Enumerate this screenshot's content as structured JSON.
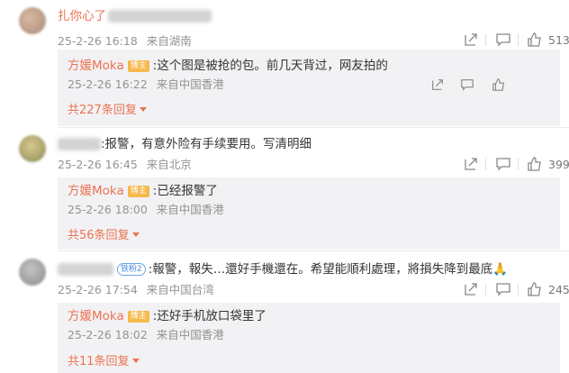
{
  "comments": [
    {
      "author": "扎你心了",
      "text_visible": "",
      "date": "25-2-26 16:18",
      "location": "来自湖南",
      "likes": "513",
      "reply": {
        "author": "方媛Moka",
        "badge": "博主",
        "text": ":这个图是被抢的包。前几天背过，网友拍的",
        "date": "25-2-26 16:22",
        "location": "来自中国香港"
      },
      "more_replies": "共227条回复"
    },
    {
      "author": "",
      "text_visible": ":报警，有意外险有手续要用。写清明细",
      "date": "25-2-26 16:45",
      "location": "来自北京",
      "likes": "399",
      "reply": {
        "author": "方媛Moka",
        "badge": "博主",
        "text": ":已经报警了",
        "date": "25-2-26 18:00",
        "location": "来自中国香港"
      },
      "more_replies": "共56条回复"
    },
    {
      "author": "",
      "user_badge": "铁粉2",
      "text_visible": ":報警，報失…還好手機還在。希望能順利處理，將損失降到最底🙏",
      "date": "25-2-26 17:54",
      "location": "来自中国台湾",
      "likes": "245",
      "reply": {
        "author": "方媛Moka",
        "badge": "博主",
        "text": ":还好手机放口袋里了",
        "date": "25-2-26 18:02",
        "location": "来自中国香港"
      },
      "more_replies": "共11条回复"
    }
  ],
  "colors": {
    "username": "#eb7350",
    "meta": "#939393",
    "reply_bg": "#f2f2f5",
    "badge": "#f6b94c"
  },
  "icons": [
    "share-icon",
    "comment-icon",
    "like-icon"
  ]
}
